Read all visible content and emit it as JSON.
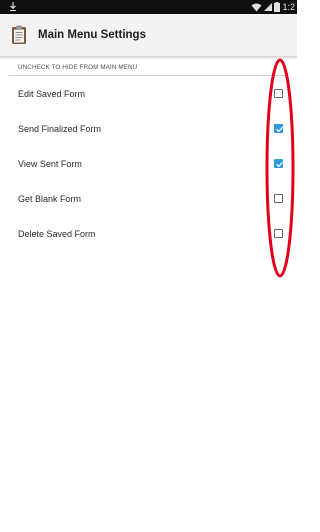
{
  "status_bar": {
    "time": "1:2",
    "download_icon": "download-icon",
    "wifi_icon": "wifi-icon",
    "signal_icon": "signal-icon",
    "battery_icon": "battery-icon"
  },
  "toolbar": {
    "title": "Main Menu Settings",
    "app_icon": "clipboard-icon"
  },
  "section": {
    "header": "UNCHECK TO HIDE FROM MAIN MENU"
  },
  "items": [
    {
      "label": "Edit Saved Form",
      "checked": false
    },
    {
      "label": "Send Finalized Form",
      "checked": true
    },
    {
      "label": "View Sent Form",
      "checked": true
    },
    {
      "label": "Get Blank Form",
      "checked": false
    },
    {
      "label": "Delete Saved Form",
      "checked": false
    }
  ],
  "colors": {
    "accent": "#2f9bdc",
    "annotation": "#e3001b",
    "status_bar": "#0f0f0f",
    "toolbar": "#f3f3f3"
  },
  "annotation": {
    "shape": "oval",
    "color": "#e3001b"
  }
}
